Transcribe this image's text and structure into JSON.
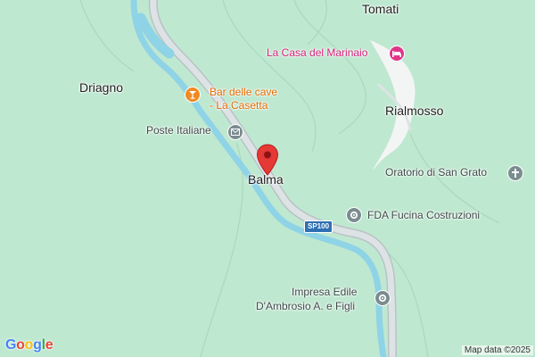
{
  "places": {
    "tomati": "Tomati",
    "driagno": "Driagno",
    "rialmosso": "Rialmosso",
    "balma": "Balma"
  },
  "pois": {
    "casa_marinaio": {
      "label": "La Casa del Marinaio",
      "icon": "lodging-icon",
      "color": "#e0358a"
    },
    "bar_cave": {
      "line1": "Bar delle cave",
      "line2": "- La Casetta",
      "icon": "cocktail-icon",
      "color": "#f08a24"
    },
    "poste": {
      "label": "Poste Italiane",
      "icon": "mail-icon"
    },
    "oratorio": {
      "label": "Oratorio di San Grato",
      "icon": "cross-icon"
    },
    "fda": {
      "label": "FDA Fucina Costruzioni",
      "icon": "gear-icon"
    },
    "impresa": {
      "line1": "Impresa Edile",
      "line2": "D'Ambrosio A. e Figli",
      "icon": "gear-icon"
    }
  },
  "road_shield": "SP100",
  "attribution": "Map data ©2025",
  "logo": {
    "text": "Google",
    "colors": [
      "#4285F4",
      "#EA4335",
      "#FBBC05",
      "#4285F4",
      "#34A853",
      "#EA4335"
    ]
  },
  "marker": {
    "icon": "location-pin-icon",
    "color": "#e53935"
  },
  "colors": {
    "land": "#bfe8d0",
    "river": "#8fd3e6",
    "road": "#d5dcdf",
    "road_edge": "#b9c2c6",
    "settlement": "#f3f5f4"
  }
}
